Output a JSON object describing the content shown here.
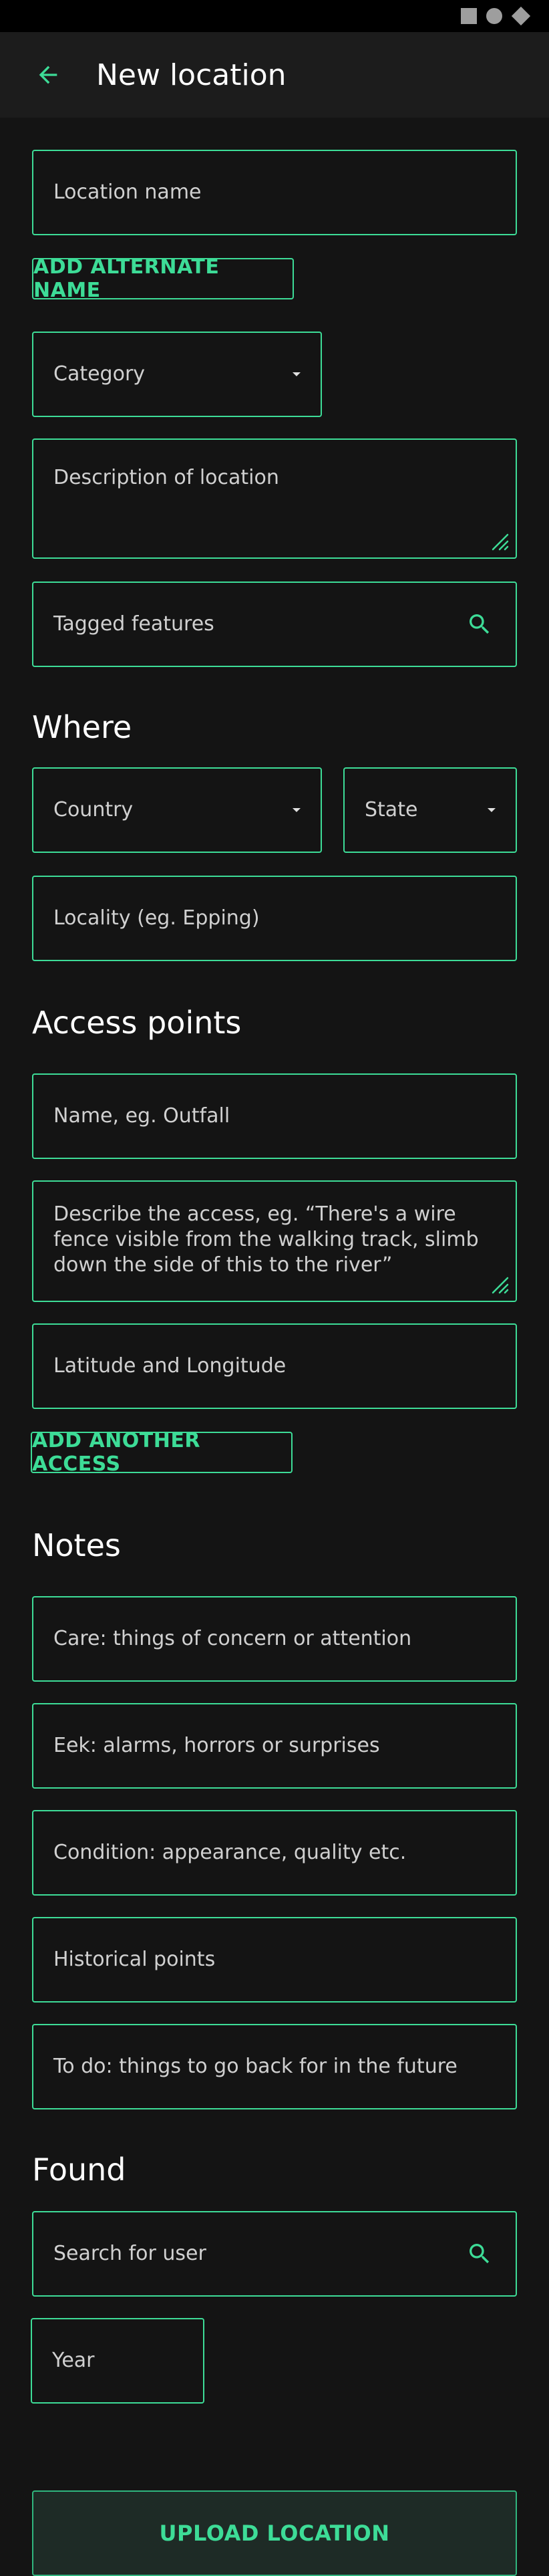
{
  "app_bar": {
    "title": "New location",
    "back_icon": "arrow-left-icon"
  },
  "form": {
    "location_name": {
      "placeholder": "Location name"
    },
    "add_alternate_name": "ADD ALTERNATE NAME",
    "category": {
      "placeholder": "Category"
    },
    "description": {
      "placeholder": "Description of location"
    },
    "tagged_features": {
      "placeholder": "Tagged features"
    }
  },
  "where": {
    "title": "Where",
    "country": {
      "placeholder": "Country"
    },
    "state": {
      "placeholder": "State"
    },
    "locality": {
      "placeholder": "Locality (eg. Epping)"
    }
  },
  "access": {
    "title": "Access points",
    "name": {
      "placeholder": "Name, eg. Outfall"
    },
    "describe": {
      "placeholder": "Describe the access, eg. “There's a wire fence visible from the walking track, slimb down the side of this to the river”"
    },
    "latlng": {
      "placeholder": "Latitude and Longitude"
    },
    "add_another": "ADD ANOTHER ACCESS"
  },
  "notes": {
    "title": "Notes",
    "care": {
      "placeholder": "Care: things of concern or attention"
    },
    "eek": {
      "placeholder": "Eek: alarms, horrors or surprises"
    },
    "condition": {
      "placeholder": "Condition: appearance, quality etc."
    },
    "historical": {
      "placeholder": "Historical points"
    },
    "todo": {
      "placeholder": "To do: things to go back for in the future"
    }
  },
  "found": {
    "title": "Found",
    "search_user": {
      "placeholder": "Search for user"
    },
    "year": {
      "placeholder": "Year"
    }
  },
  "upload_button": "UPLOAD LOCATION",
  "colors": {
    "accent": "#3ddc97",
    "background": "#141414",
    "app_bar": "#1c1c1c",
    "status_bar": "#000000"
  }
}
